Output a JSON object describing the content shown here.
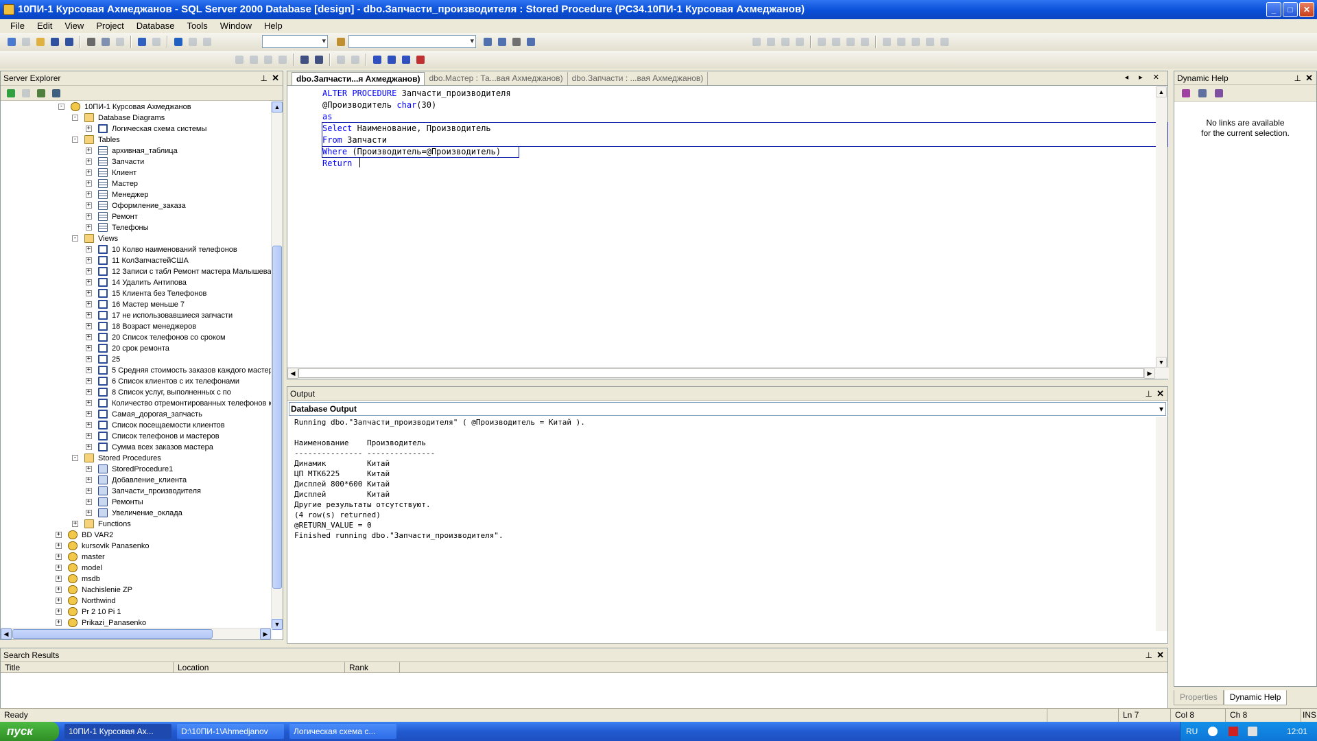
{
  "window": {
    "title": "10ПИ-1 Курсовая Ахмеджанов - SQL Server 2000 Database [design] - dbo.Запчасти_производителя : Stored Procedure (PC34.10ПИ-1 Курсовая Ахмеджанов)",
    "controls": {
      "minimize": "_",
      "maximize": "□",
      "close": "✕"
    }
  },
  "menu": [
    "File",
    "Edit",
    "View",
    "Project",
    "Database",
    "Tools",
    "Window",
    "Help"
  ],
  "server_explorer": {
    "title": "Server Explorer",
    "pin": "⊥",
    "close": "✕",
    "nodes": [
      {
        "label": "10ПИ-1 Курсовая Ахмеджанов",
        "level": 0,
        "exp": "-",
        "icon": "db"
      },
      {
        "label": "Database Diagrams",
        "level": 1,
        "exp": "-",
        "icon": "fold"
      },
      {
        "label": "Логическая схема системы",
        "level": 2,
        "exp": "+",
        "icon": "view"
      },
      {
        "label": "Tables",
        "level": 1,
        "exp": "-",
        "icon": "fold"
      },
      {
        "label": "архивная_таблица",
        "level": 2,
        "exp": "+",
        "icon": "tbl"
      },
      {
        "label": "Запчасти",
        "level": 2,
        "exp": "+",
        "icon": "tbl"
      },
      {
        "label": "Клиент",
        "level": 2,
        "exp": "+",
        "icon": "tbl"
      },
      {
        "label": "Мастер",
        "level": 2,
        "exp": "+",
        "icon": "tbl"
      },
      {
        "label": "Менеджер",
        "level": 2,
        "exp": "+",
        "icon": "tbl"
      },
      {
        "label": "Оформление_заказа",
        "level": 2,
        "exp": "+",
        "icon": "tbl"
      },
      {
        "label": "Ремонт",
        "level": 2,
        "exp": "+",
        "icon": "tbl"
      },
      {
        "label": "Телефоны",
        "level": 2,
        "exp": "+",
        "icon": "tbl"
      },
      {
        "label": "Views",
        "level": 1,
        "exp": "-",
        "icon": "fold"
      },
      {
        "label": "10 Колво наименований телефонов",
        "level": 2,
        "exp": "+",
        "icon": "view"
      },
      {
        "label": "11 КолЗапчастейСША",
        "level": 2,
        "exp": "+",
        "icon": "view"
      },
      {
        "label": "12 Записи с табл Ремонт мастера Малышева",
        "level": 2,
        "exp": "+",
        "icon": "view"
      },
      {
        "label": "14 Удалить Антипова",
        "level": 2,
        "exp": "+",
        "icon": "view"
      },
      {
        "label": "15 Клиента без Телефонов",
        "level": 2,
        "exp": "+",
        "icon": "view"
      },
      {
        "label": "16 Мастер меньше 7",
        "level": 2,
        "exp": "+",
        "icon": "view"
      },
      {
        "label": "17 не использовавшиеся запчасти",
        "level": 2,
        "exp": "+",
        "icon": "view"
      },
      {
        "label": "18 Возраст менеджеров",
        "level": 2,
        "exp": "+",
        "icon": "view"
      },
      {
        "label": "20 Список телефонов со сроком",
        "level": 2,
        "exp": "+",
        "icon": "view"
      },
      {
        "label": "20 срок ремонта",
        "level": 2,
        "exp": "+",
        "icon": "view"
      },
      {
        "label": "25",
        "level": 2,
        "exp": "+",
        "icon": "view"
      },
      {
        "label": "5 Средняя стоимость заказов каждого мастер",
        "level": 2,
        "exp": "+",
        "icon": "view"
      },
      {
        "label": "6 Список клиентов с их телефонами",
        "level": 2,
        "exp": "+",
        "icon": "view"
      },
      {
        "label": "8 Список услуг, выполненных  с по",
        "level": 2,
        "exp": "+",
        "icon": "view"
      },
      {
        "label": "Количество отремонтированных телефонов к",
        "level": 2,
        "exp": "+",
        "icon": "view"
      },
      {
        "label": "Самая_дорогая_запчасть",
        "level": 2,
        "exp": "+",
        "icon": "view"
      },
      {
        "label": "Список посещаемости клиентов",
        "level": 2,
        "exp": "+",
        "icon": "view"
      },
      {
        "label": "Список телефонов и мастеров",
        "level": 2,
        "exp": "+",
        "icon": "view"
      },
      {
        "label": "Сумма всех заказов мастера",
        "level": 2,
        "exp": "+",
        "icon": "view"
      },
      {
        "label": "Stored Procedures",
        "level": 1,
        "exp": "-",
        "icon": "fold"
      },
      {
        "label": "StoredProcedure1",
        "level": 2,
        "exp": "+",
        "icon": "proc"
      },
      {
        "label": "Добавление_клиента",
        "level": 2,
        "exp": "+",
        "icon": "proc"
      },
      {
        "label": "Запчасти_производителя",
        "level": 2,
        "exp": "+",
        "icon": "proc"
      },
      {
        "label": "Ремонты",
        "level": 2,
        "exp": "+",
        "icon": "proc"
      },
      {
        "label": "Увеличение_оклада",
        "level": 2,
        "exp": "+",
        "icon": "proc"
      },
      {
        "label": "Functions",
        "level": 1,
        "exp": "+",
        "icon": "fold"
      },
      {
        "label": "BD VAR2",
        "level": -1,
        "exp": "+",
        "icon": "db"
      },
      {
        "label": "kursovik Panasenko",
        "level": -1,
        "exp": "+",
        "icon": "db"
      },
      {
        "label": "master",
        "level": -1,
        "exp": "+",
        "icon": "db"
      },
      {
        "label": "model",
        "level": -1,
        "exp": "+",
        "icon": "db"
      },
      {
        "label": "msdb",
        "level": -1,
        "exp": "+",
        "icon": "db"
      },
      {
        "label": "Nachislenie ZP",
        "level": -1,
        "exp": "+",
        "icon": "db"
      },
      {
        "label": "Northwind",
        "level": -1,
        "exp": "+",
        "icon": "db"
      },
      {
        "label": "Pr 2 10 Pi 1",
        "level": -1,
        "exp": "+",
        "icon": "db"
      },
      {
        "label": "Prikazi_Panasenko",
        "level": -1,
        "exp": "+",
        "icon": "db"
      }
    ]
  },
  "editor": {
    "tabs": [
      {
        "label": "dbo.Запчасти...я Ахмеджанов)",
        "active": true
      },
      {
        "label": "dbo.Мастер : Та...вая Ахмеджанов)",
        "active": false
      },
      {
        "label": "dbo.Запчасти : ...вая Ахмеджанов)",
        "active": false
      }
    ],
    "tab_controls": "◂ ▸ ✕",
    "lines": [
      [
        {
          "t": "ALTER PROCEDURE",
          "k": true
        },
        {
          "t": " Запчасти_производителя",
          "k": false
        }
      ],
      [
        {
          "t": "@Производитель ",
          "k": false
        },
        {
          "t": "char",
          "k": true
        },
        {
          "t": "(30)",
          "k": false
        }
      ],
      [
        {
          "t": "as",
          "k": true
        }
      ],
      [
        {
          "t": "Select",
          "k": true
        },
        {
          "t": " Наименование, Производитель",
          "k": false
        }
      ],
      [
        {
          "t": "From",
          "k": true
        },
        {
          "t": " Запчасти",
          "k": false
        }
      ],
      [
        {
          "t": "Where",
          "k": true
        },
        {
          "t": " (Производитель=@Производитель)",
          "k": false
        }
      ],
      [
        {
          "t": "Return",
          "k": true
        },
        {
          "t": " ",
          "k": false
        }
      ]
    ]
  },
  "output": {
    "title": "Output",
    "pin": "⊥",
    "close": "✕",
    "pane": "Database Output",
    "text": "Running dbo.\"Запчасти_производителя\" ( @Производитель = Китай ).\n\nНаименование    Производитель\n--------------- ---------------\nДинамик         Китай\nЦП MTK6225      Китай\nДисплей 800*600 Китай\nДисплей         Китай\nДругие результаты отсутствуют.\n(4 row(s) returned)\n@RETURN_VALUE = 0\nFinished running dbo.\"Запчасти_производителя\"."
  },
  "search_results": {
    "title": "Search Results",
    "pin": "⊥",
    "close": "✕",
    "columns": [
      "Title",
      "Location",
      "Rank"
    ]
  },
  "dynamic_help": {
    "title": "Dynamic Help",
    "pin": "⊥",
    "close": "✕",
    "message_1": "No links are available",
    "message_2": "for the current selection.",
    "tab_properties": "Properties",
    "tab_dynamic_help": "Dynamic Help"
  },
  "status": {
    "ready": "Ready",
    "ln": "Ln 7",
    "col": "Col 8",
    "ch": "Ch 8",
    "ins": "INS"
  },
  "taskbar": {
    "start": "пуск",
    "tasks": [
      {
        "label": "10ПИ-1 Курсовая Ах...",
        "active": true
      },
      {
        "label": "D:\\10ПИ-1\\Ahmedjanov",
        "active": false
      },
      {
        "label": "Логическая схема с...",
        "active": false
      }
    ],
    "lang": "RU",
    "clock": "12:01"
  }
}
